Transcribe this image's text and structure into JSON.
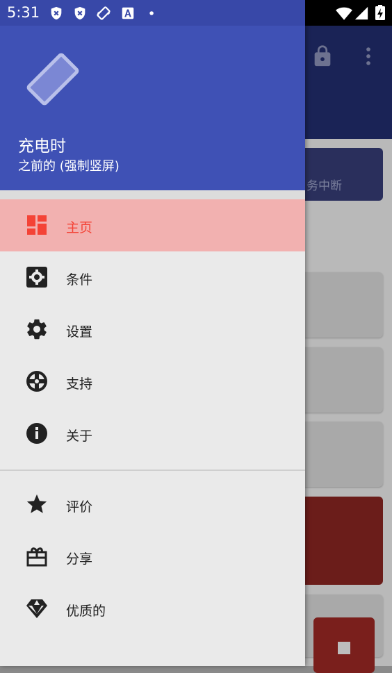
{
  "status_bar": {
    "time": "5:31"
  },
  "background": {
    "banner_text": "务中断"
  },
  "drawer_header": {
    "title": "充电时",
    "subtitle": "之前的 (强制竖屏)"
  },
  "menu": {
    "items": [
      {
        "label": "主页",
        "icon": "dashboard-icon",
        "active": true
      },
      {
        "label": "条件",
        "icon": "settings-box-icon"
      },
      {
        "label": "设置",
        "icon": "gear-icon"
      },
      {
        "label": "支持",
        "icon": "lifebuoy-icon"
      },
      {
        "label": "关于",
        "icon": "info-icon"
      }
    ],
    "secondary_items": [
      {
        "label": "评价",
        "icon": "star-icon"
      },
      {
        "label": "分享",
        "icon": "gift-icon"
      },
      {
        "label": "优质的",
        "icon": "diamond-icon"
      }
    ]
  },
  "colors": {
    "header": "#3f51b5",
    "active_item_bg": "#f2b1b0",
    "active_item_text": "#f44336"
  }
}
